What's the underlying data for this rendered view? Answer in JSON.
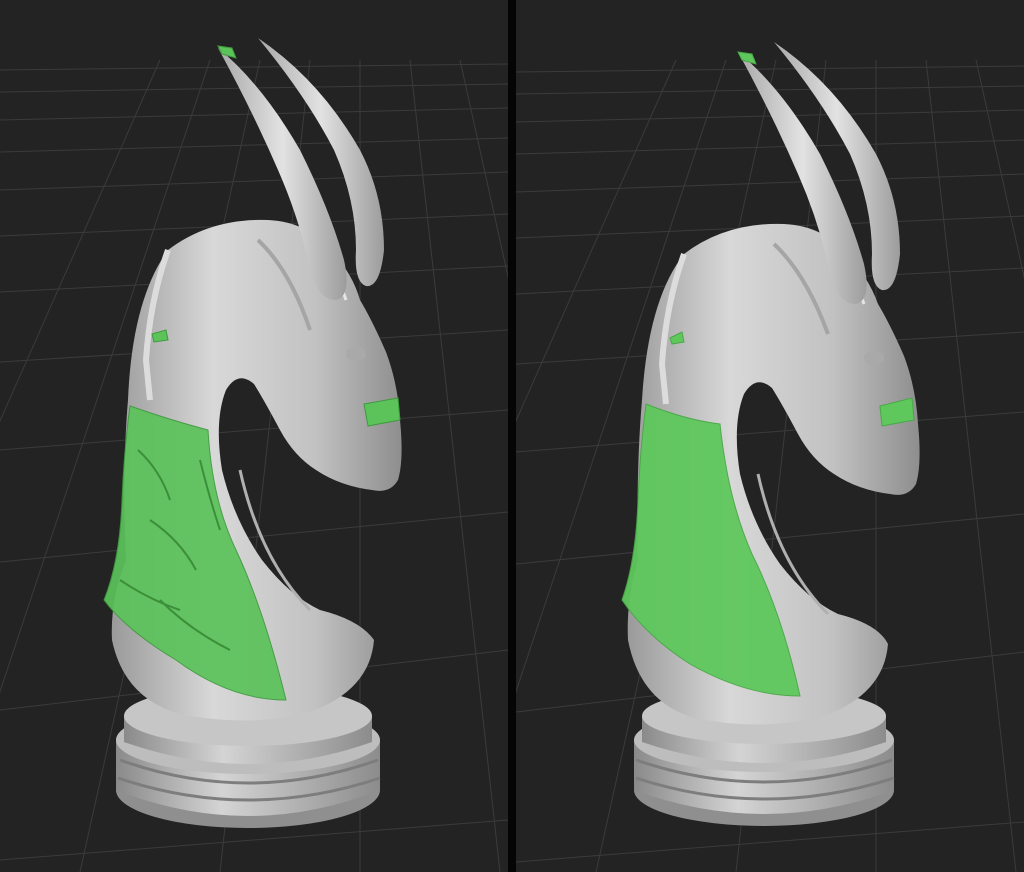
{
  "viewports": [
    {
      "name": "viewport-left",
      "label": "",
      "mask_color": "#5cc25a",
      "mask_style": "rough"
    },
    {
      "name": "viewport-right",
      "label": "",
      "mask_color": "#5fc85d",
      "mask_style": "smooth"
    }
  ],
  "colors": {
    "background": "#232323",
    "grid_line": "#3a3a3a",
    "model": "#c8c8c8",
    "divider": "#050505"
  }
}
